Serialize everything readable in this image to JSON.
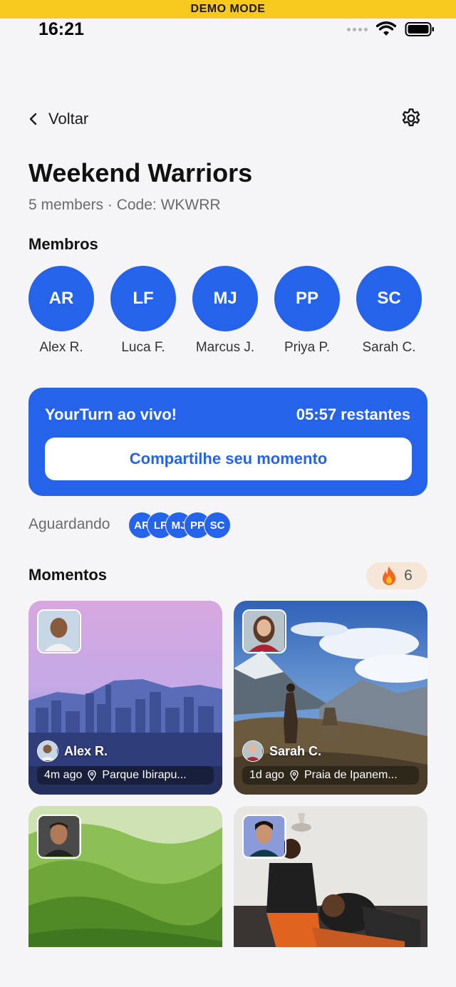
{
  "demo_banner": "DEMO MODE",
  "status_bar": {
    "time": "16:21"
  },
  "nav": {
    "back_label": "Voltar",
    "back_icon": "chevron-left-icon",
    "settings_icon": "gear-icon"
  },
  "group": {
    "name": "Weekend Warriors",
    "subtitle": "5 members · Code: WKWRR"
  },
  "members_section": {
    "title": "Membros",
    "members": [
      {
        "initials": "AR",
        "name": "Alex R."
      },
      {
        "initials": "LF",
        "name": "Luca F."
      },
      {
        "initials": "MJ",
        "name": "Marcus J."
      },
      {
        "initials": "PP",
        "name": "Priya P."
      },
      {
        "initials": "SC",
        "name": "Sarah C."
      }
    ]
  },
  "live": {
    "title": "YourTurn ao vivo!",
    "time_left": "05:57 restantes",
    "share_button": "Compartilhe seu momento"
  },
  "waiting": {
    "label": "Aguardando",
    "initials": [
      "AR",
      "LF",
      "MJ",
      "PP",
      "SC"
    ]
  },
  "moments": {
    "title": "Momentos",
    "streak_icon": "flame-icon",
    "streak_count": "6",
    "items": [
      {
        "author": "Alex R.",
        "time": "4m ago",
        "location": "Parque Ibirapu..."
      },
      {
        "author": "Sarah C.",
        "time": "1d ago",
        "location": "Praia de Ipanem..."
      },
      {
        "author": "",
        "time": "",
        "location": ""
      },
      {
        "author": "",
        "time": "",
        "location": ""
      }
    ]
  },
  "colors": {
    "accent": "#2563eb",
    "demo_banner": "#f7c81e",
    "background": "#f5f5f7",
    "streak_bg": "#f6e6d8"
  }
}
